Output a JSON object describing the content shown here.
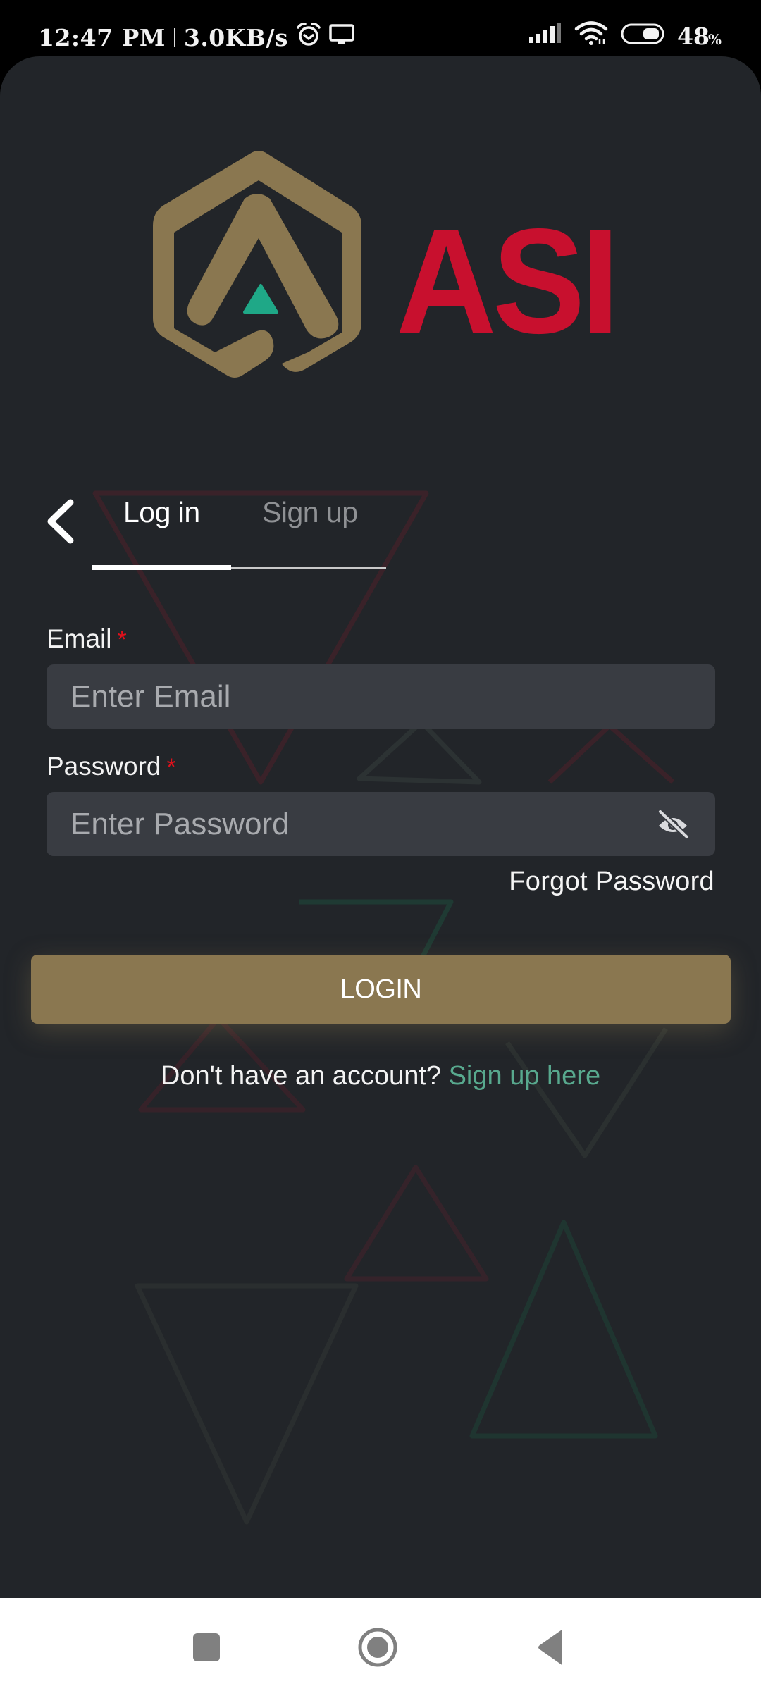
{
  "status_bar": {
    "time": "12:47 PM",
    "network_speed": "3.0KB/s",
    "icons": [
      "alarm-icon",
      "screen-cast-icon",
      "signal-icon",
      "wifi-icon",
      "battery-icon"
    ],
    "battery_percent": "48",
    "battery_suffix": "%",
    "battery_level": 0.48
  },
  "brand": {
    "name": "ASI",
    "colors": {
      "gold": "#8A7750",
      "red": "#C8102E",
      "teal": "#1FA887"
    }
  },
  "tabs": {
    "back_icon": "chevron-left-icon",
    "items": [
      {
        "label": "Log in",
        "active": true
      },
      {
        "label": "Sign up",
        "active": false
      }
    ]
  },
  "form": {
    "email": {
      "label": "Email",
      "required_mark": "*",
      "value": "",
      "placeholder": "Enter Email"
    },
    "password": {
      "label": "Password",
      "required_mark": "*",
      "value": "",
      "placeholder": "Enter Password",
      "toggle_icon": "eye-off-icon"
    },
    "forgot_password": "Forgot Password",
    "submit_label": "LOGIN",
    "signup_prompt": "Don't have an account?",
    "signup_link": "Sign up here"
  },
  "nav_bar": {
    "buttons": [
      "recents-icon",
      "home-icon",
      "back-icon"
    ]
  },
  "colors": {
    "background": "#222529",
    "input_bg": "#393C42",
    "button": "#8A7750",
    "link": "#58A98E",
    "required": "#E0101B"
  }
}
